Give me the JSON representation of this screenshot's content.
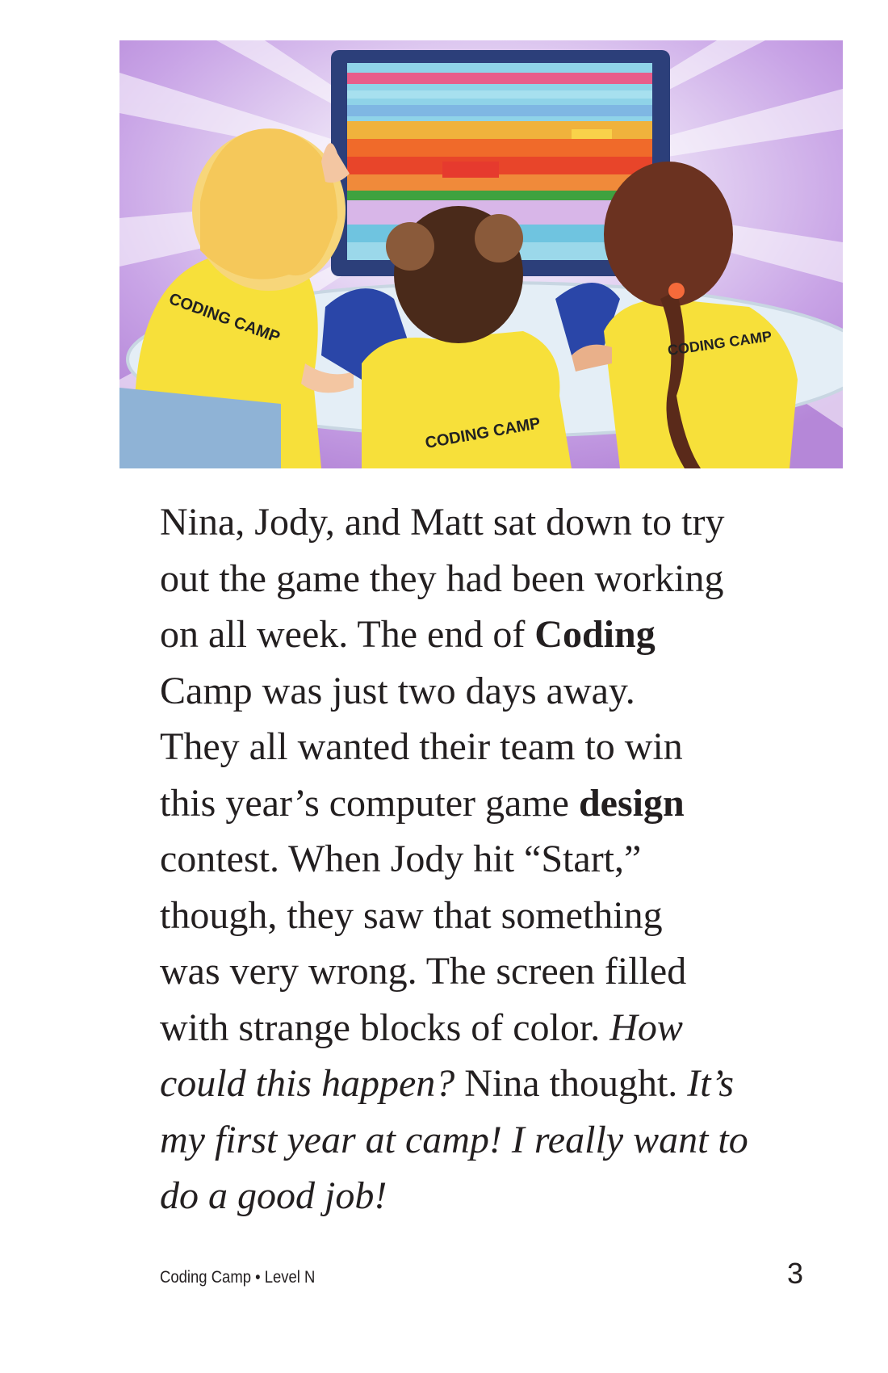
{
  "illustration": {
    "shirt_text_left": "CODING CAMP",
    "shirt_text_center": "CODING CAMP",
    "shirt_text_right": "CODING CAMP"
  },
  "story": {
    "lines": [
      [
        {
          "t": "Nina, Jody, and Matt sat down to try",
          "s": "normal"
        }
      ],
      [
        {
          "t": "out the game they had been working",
          "s": "normal"
        }
      ],
      [
        {
          "t": "on all week. The end of ",
          "s": "normal"
        },
        {
          "t": "Coding",
          "s": "bold"
        }
      ],
      [
        {
          "t": "Camp was just two days away.",
          "s": "normal"
        }
      ],
      [
        {
          "t": "They all wanted their team to win",
          "s": "normal"
        }
      ],
      [
        {
          "t": "this year’s computer game ",
          "s": "normal"
        },
        {
          "t": "design",
          "s": "bold"
        }
      ],
      [
        {
          "t": "contest. When Jody hit “Start,”",
          "s": "normal"
        }
      ],
      [
        {
          "t": "though, they saw that something",
          "s": "normal"
        }
      ],
      [
        {
          "t": "was very wrong. The screen filled",
          "s": "normal"
        }
      ],
      [
        {
          "t": "with strange blocks of color. ",
          "s": "normal"
        },
        {
          "t": "How",
          "s": "italic"
        }
      ],
      [
        {
          "t": "could this happen?",
          "s": "italic"
        },
        {
          "t": " Nina thought. ",
          "s": "normal"
        },
        {
          "t": "It’s",
          "s": "italic"
        }
      ],
      [
        {
          "t": "my first year at camp! I really want to",
          "s": "italic"
        }
      ],
      [
        {
          "t": "do a good job!",
          "s": "italic"
        }
      ]
    ]
  },
  "footer": {
    "book_info": "Coding Camp • Level N",
    "page_number": "3"
  },
  "colors": {
    "text": "#231f20",
    "shirt": "#f6e23a",
    "background_purple": "#c9a2e6"
  }
}
